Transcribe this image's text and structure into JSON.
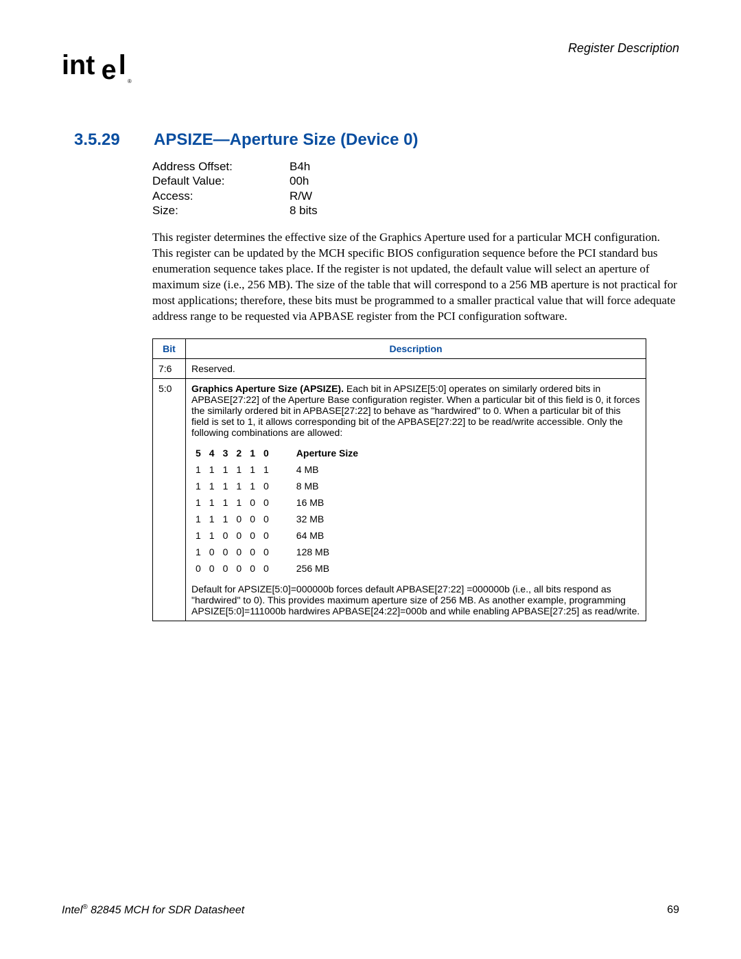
{
  "header": {
    "label": "Register Description"
  },
  "section": {
    "number": "3.5.29",
    "title": "APSIZE—Aperture Size (Device 0)"
  },
  "meta": {
    "address_offset_label": "Address Offset:",
    "address_offset_value": "B4h",
    "default_value_label": "Default Value:",
    "default_value_value": "00h",
    "access_label": "Access:",
    "access_value": "R/W",
    "size_label": "Size:",
    "size_value": "8 bits"
  },
  "paragraph": "This register determines the effective size of the Graphics Aperture used for a particular MCH configuration. This register can be updated by the MCH specific BIOS configuration sequence before the PCI standard bus enumeration sequence takes place. If the register is not updated, the default value will select an aperture of maximum size (i.e., 256 MB). The size of the table that will correspond to a 256 MB aperture is not practical for most applications; therefore, these bits must be programmed to a smaller practical value that will force adequate address range to be requested via APBASE register from the PCI configuration software.",
  "table": {
    "col_bit": "Bit",
    "col_desc": "Description",
    "row1_bit": "7:6",
    "row1_desc": "Reserved.",
    "row2_bit": "5:0",
    "row2_desc_bold": "Graphics Aperture Size (APSIZE). ",
    "row2_desc": "Each bit in APSIZE[5:0] operates on similarly ordered bits in APBASE[27:22] of the Aperture Base configuration register. When a particular bit of this field is 0, it forces the similarly ordered bit in APBASE[27:22] to behave as \"hardwired\" to 0. When a particular bit of this field is set to 1, it allows corresponding bit of the APBASE[27:22] to be read/write accessible. Only the following combinations are allowed:",
    "row2_foot": "Default for APSIZE[5:0]=000000b forces default APBASE[27:22] =000000b (i.e., all bits respond as \"hardwired\" to 0). This provides maximum aperture size of 256 MB. As another example, programming APSIZE[5:0]=111000b hardwires APBASE[24:22]=000b and while enabling APBASE[27:25] as read/write."
  },
  "bits_header": {
    "b5": "5",
    "b4": "4",
    "b3": "3",
    "b2": "2",
    "b1": "1",
    "b0": "0",
    "label": "Aperture Size"
  },
  "bits": [
    {
      "b5": "1",
      "b4": "1",
      "b3": "1",
      "b2": "1",
      "b1": "1",
      "b0": "1",
      "size": "4 MB"
    },
    {
      "b5": "1",
      "b4": "1",
      "b3": "1",
      "b2": "1",
      "b1": "1",
      "b0": "0",
      "size": "8 MB"
    },
    {
      "b5": "1",
      "b4": "1",
      "b3": "1",
      "b2": "1",
      "b1": "0",
      "b0": "0",
      "size": "16 MB"
    },
    {
      "b5": "1",
      "b4": "1",
      "b3": "1",
      "b2": "0",
      "b1": "0",
      "b0": "0",
      "size": "32 MB"
    },
    {
      "b5": "1",
      "b4": "1",
      "b3": "0",
      "b2": "0",
      "b1": "0",
      "b0": "0",
      "size": "64 MB"
    },
    {
      "b5": "1",
      "b4": "0",
      "b3": "0",
      "b2": "0",
      "b1": "0",
      "b0": "0",
      "size": "128 MB"
    },
    {
      "b5": "0",
      "b4": "0",
      "b3": "0",
      "b2": "0",
      "b1": "0",
      "b0": "0",
      "size": "256 MB"
    }
  ],
  "footer": {
    "doc_prefix": "Intel",
    "doc_reg": "®",
    "doc_suffix": " 82845 MCH for SDR Datasheet",
    "page": "69"
  }
}
